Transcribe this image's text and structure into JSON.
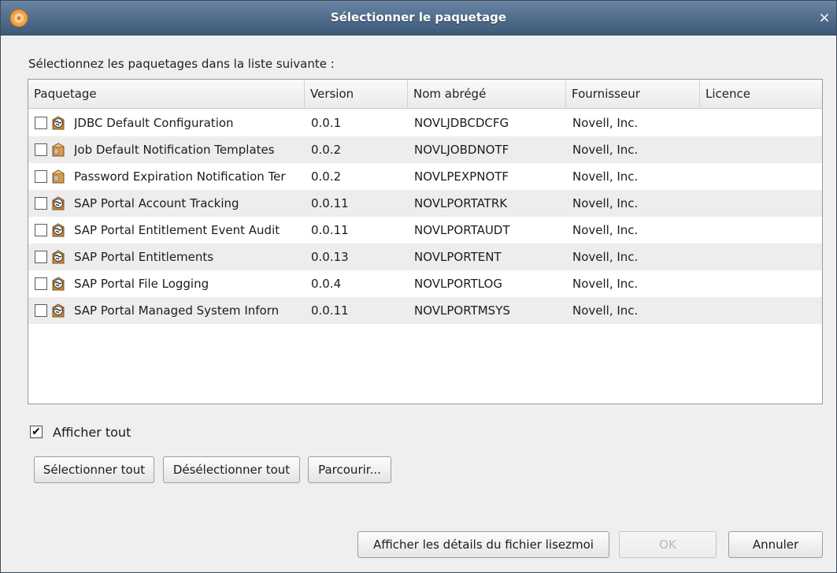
{
  "window": {
    "title": "Sélectionner le paquetage",
    "close_label": "×"
  },
  "instruction": "Sélectionnez les paquetages dans la liste suivante :",
  "table": {
    "columns": [
      "Paquetage",
      "Version",
      "Nom abrégé",
      "Fournisseur",
      "Licence"
    ],
    "rows": [
      {
        "name": "JDBC Default Configuration",
        "version": "0.0.1",
        "short_name": "NOVLJDBCDCFG",
        "vendor": "Novell, Inc.",
        "license": "",
        "checked": false,
        "icon": "globe-package-icon"
      },
      {
        "name": "Job Default Notification Templates",
        "version": "0.0.2",
        "short_name": "NOVLJOBDNOTF",
        "vendor": "Novell, Inc.",
        "license": "",
        "checked": false,
        "icon": "box-package-icon"
      },
      {
        "name": "Password Expiration Notification Ter",
        "version": "0.0.2",
        "short_name": "NOVLPEXPNOTF",
        "vendor": "Novell, Inc.",
        "license": "",
        "checked": false,
        "icon": "box-package-icon"
      },
      {
        "name": "SAP Portal Account Tracking",
        "version": "0.0.11",
        "short_name": "NOVLPORTATRK",
        "vendor": "Novell, Inc.",
        "license": "",
        "checked": false,
        "icon": "globe-package-icon"
      },
      {
        "name": "SAP Portal Entitlement Event Audit",
        "version": "0.0.11",
        "short_name": "NOVLPORTAUDT",
        "vendor": "Novell, Inc.",
        "license": "",
        "checked": false,
        "icon": "globe-package-icon"
      },
      {
        "name": "SAP Portal Entitlements",
        "version": "0.0.13",
        "short_name": "NOVLPORTENT",
        "vendor": "Novell, Inc.",
        "license": "",
        "checked": false,
        "icon": "globe-package-icon"
      },
      {
        "name": "SAP Portal File Logging",
        "version": "0.0.4",
        "short_name": "NOVLPORTLOG",
        "vendor": "Novell, Inc.",
        "license": "",
        "checked": false,
        "icon": "globe-package-icon"
      },
      {
        "name": "SAP Portal Managed System Inforn",
        "version": "0.0.11",
        "short_name": "NOVLPORTMSYS",
        "vendor": "Novell, Inc.",
        "license": "",
        "checked": false,
        "icon": "globe-package-icon"
      }
    ]
  },
  "show_all": {
    "label": "Afficher tout",
    "checked": true
  },
  "buttons": {
    "select_all": "Sélectionner tout",
    "deselect_all": "Désélectionner tout",
    "browse": "Parcourir...",
    "readme": "Afficher les détails du fichier lisezmoi",
    "ok": "OK",
    "cancel": "Annuler"
  },
  "colors": {
    "titlebar": "#54708f",
    "alt_row": "#ededed",
    "window_bg": "#efefef"
  }
}
